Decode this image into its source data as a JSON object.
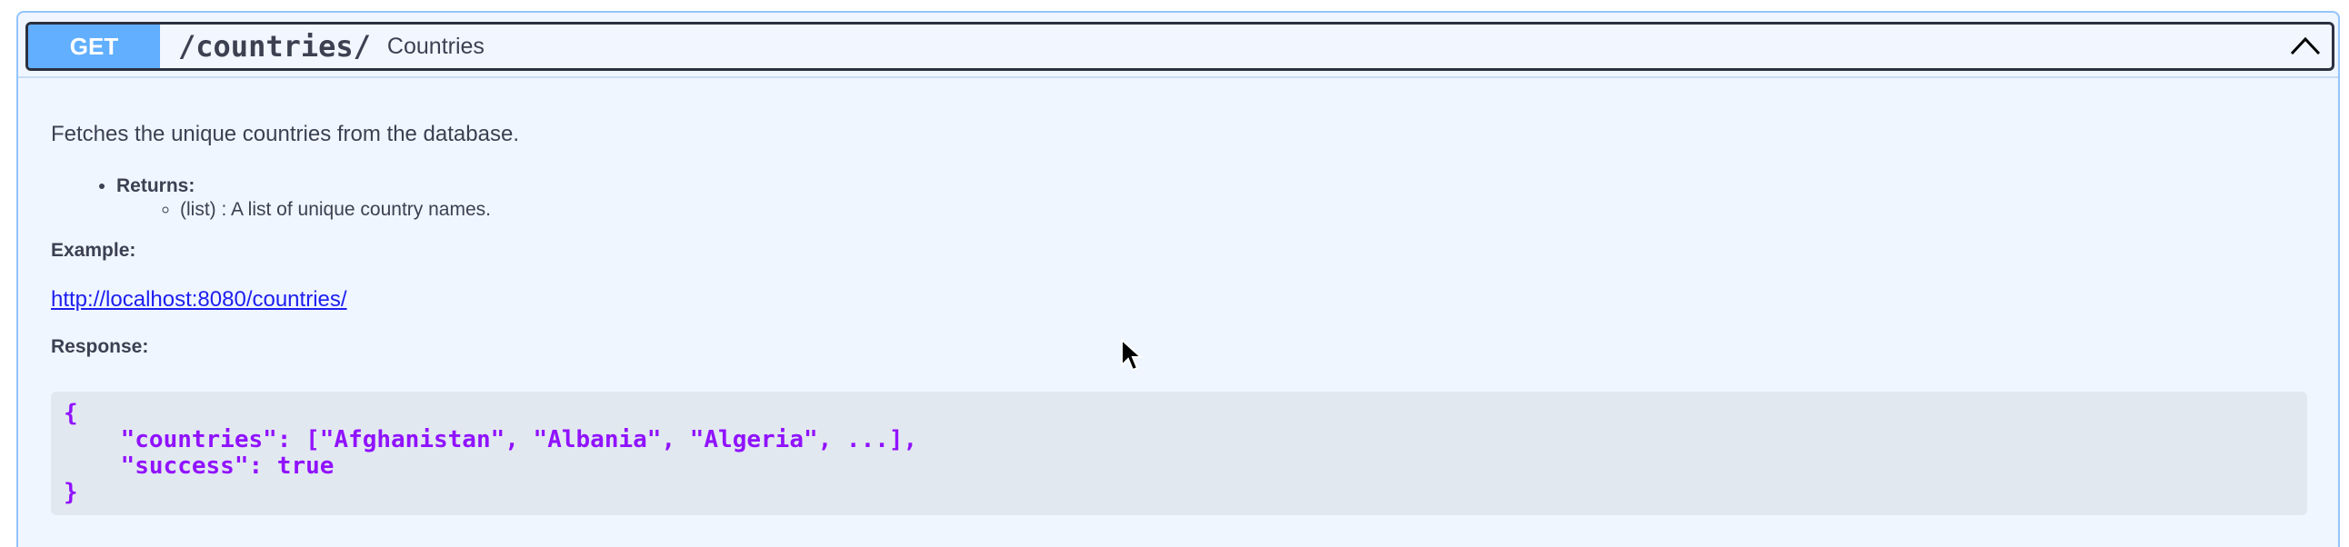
{
  "operation": {
    "method": "GET",
    "path": "/countries/",
    "summary": "Countries"
  },
  "description": {
    "lead": "Fetches the unique countries from the database.",
    "returns_label": "Returns:",
    "returns_item": "(list) : A list of unique country names.",
    "example_label": "Example:",
    "example_url": "http://localhost:8080/countries/",
    "response_label": "Response:",
    "response_code": "{\n    \"countries\": [\"Afghanistan\", \"Albania\", \"Algeria\", ...],\n    \"success\": true\n}"
  },
  "colors": {
    "method_bg": "#61affe",
    "panel_bg": "#eff6ff",
    "code_text": "#9012fe"
  },
  "icons": {
    "collapse": "chevron-up-icon",
    "cursor": "mouse-cursor-icon"
  }
}
